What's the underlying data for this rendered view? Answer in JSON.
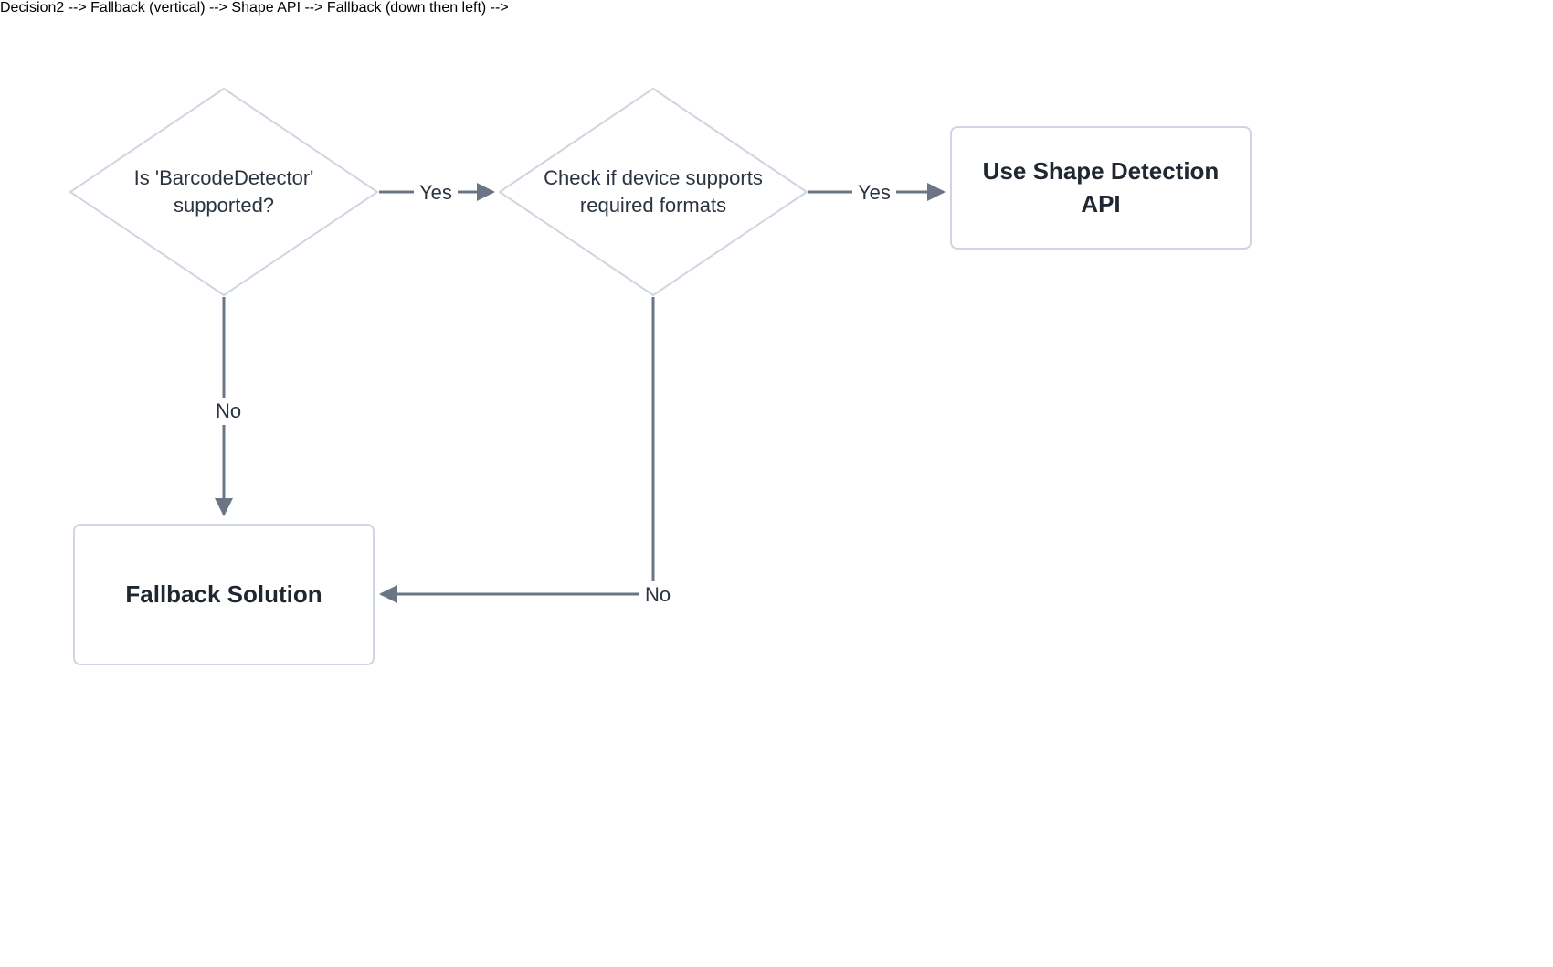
{
  "nodes": {
    "decision1": {
      "line1": "Is 'BarcodeDetector'",
      "line2": "supported?"
    },
    "decision2": {
      "line1": "Check if device supports",
      "line2": "required formats"
    },
    "shapeApi": {
      "line1": "Use Shape Detection",
      "line2": "API"
    },
    "fallback": {
      "text": "Fallback Solution"
    }
  },
  "edges": {
    "d1_yes": "Yes",
    "d1_no": "No",
    "d2_yes": "Yes",
    "d2_no": "No"
  },
  "colors": {
    "nodeStroke": "#cdd6e1",
    "connector": "#6a7683",
    "text": "#2a3440"
  }
}
